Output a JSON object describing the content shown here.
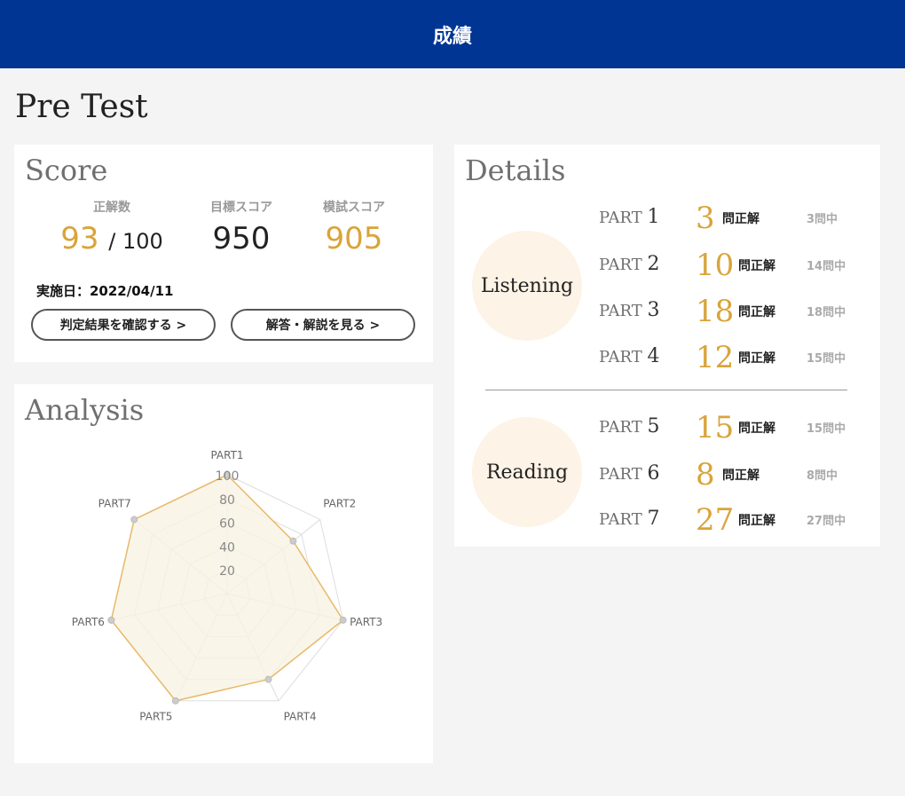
{
  "header": {
    "title": "成績"
  },
  "page": {
    "title": "Pre Test"
  },
  "score": {
    "title": "Score",
    "correct_label": "正解数",
    "correct_value": "93",
    "correct_total": "/ 100",
    "target_label": "目標スコア",
    "target_value": "950",
    "mock_label": "模試スコア",
    "mock_value": "905",
    "date": "実施日：2022/04/11",
    "judge_button": "判定結果を確認する >",
    "answer_button": "解答・解説を見る >"
  },
  "details": {
    "title": "Details",
    "listening_label": "Listening",
    "reading_label": "Reading",
    "correct_suffix": "問正解",
    "parts": [
      {
        "prefix": "PART",
        "num": "1",
        "correct": "3",
        "total": "3問中"
      },
      {
        "prefix": "PART",
        "num": "2",
        "correct": "10",
        "total": "14問中"
      },
      {
        "prefix": "PART",
        "num": "3",
        "correct": "18",
        "total": "18問中"
      },
      {
        "prefix": "PART",
        "num": "4",
        "correct": "12",
        "total": "15問中"
      },
      {
        "prefix": "PART",
        "num": "5",
        "correct": "15",
        "total": "15問中"
      },
      {
        "prefix": "PART",
        "num": "6",
        "correct": "8",
        "total": "8問中"
      },
      {
        "prefix": "PART",
        "num": "7",
        "correct": "27",
        "total": "27問中"
      }
    ]
  },
  "analysis": {
    "title": "Analysis"
  },
  "chart_data": {
    "type": "radar",
    "categories": [
      "PART1",
      "PART2",
      "PART3",
      "PART4",
      "PART5",
      "PART6",
      "PART7"
    ],
    "values": [
      100,
      71,
      100,
      80,
      100,
      100,
      100
    ],
    "ticks": [
      "20",
      "40",
      "60",
      "80",
      "100"
    ],
    "range": [
      0,
      100
    ],
    "grid": true,
    "colors": {
      "line": "#e8b96a",
      "fill": "#f7f2e3",
      "grid": "#dddddd",
      "point": "#cccccc"
    }
  }
}
